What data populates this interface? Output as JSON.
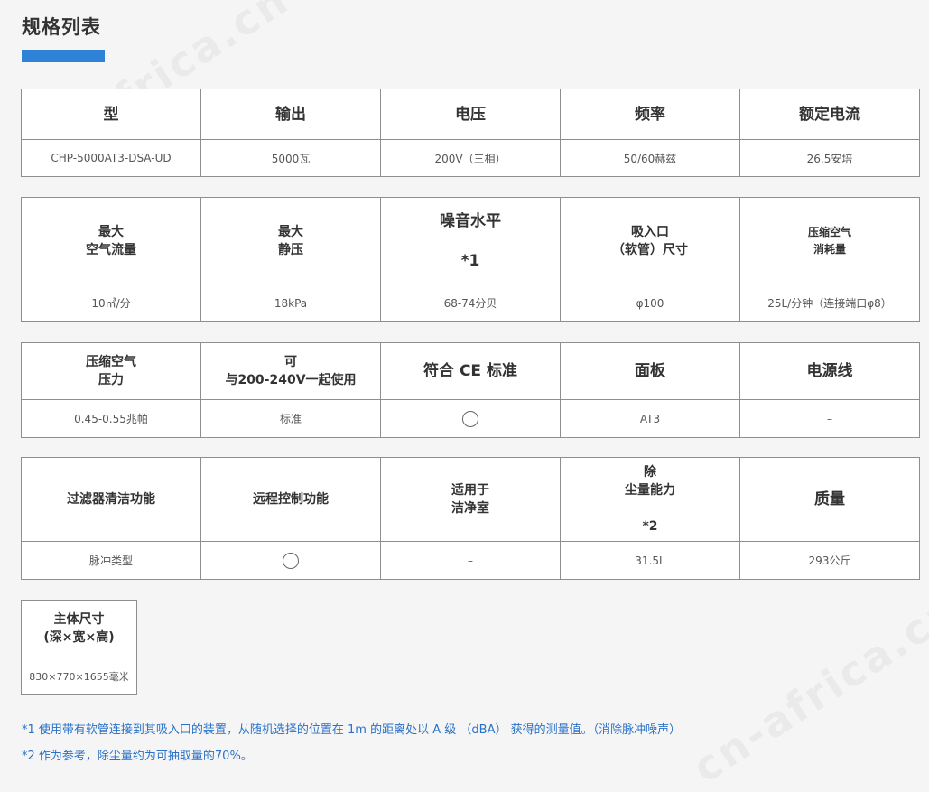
{
  "title": "规格列表",
  "accent_color": "#2f83d6",
  "watermark": "cn-africa.cn",
  "table1": {
    "headers": [
      "型",
      "输出",
      "电压",
      "频率",
      "额定电流"
    ],
    "values": [
      "CHP-5000AT3-DSA-UD",
      "5000瓦",
      "200V（三相）",
      "50/60赫兹",
      "26.5安培"
    ]
  },
  "table2": {
    "headers": [
      "最大\n空气流量",
      "最大\n静压",
      "噪音水平\n\n*1",
      "吸入口\n（软管）尺寸",
      "压缩空气\n消耗量"
    ],
    "values": [
      "10㎥/分",
      "18kPa",
      "68-74分贝",
      "φ100",
      "25L/分钟（连接端口φ8）"
    ]
  },
  "table3": {
    "headers": [
      "压缩空气\n压力",
      "可\n与200-240V一起使用",
      "符合 CE 标准",
      "面板",
      "电源线"
    ],
    "values": [
      "0.45-0.55兆帕",
      "标准",
      "",
      "AT3",
      "–"
    ]
  },
  "table4": {
    "headers": [
      "过滤器清洁功能",
      "远程控制功能",
      "适用于\n洁净室",
      "除\n尘量能力\n\n*2",
      "质量"
    ],
    "values": [
      "脉冲类型",
      "",
      "–",
      "31.5L",
      "293公斤"
    ]
  },
  "table5": {
    "header": "主体尺寸\n(深×宽×高)",
    "value": "830×770×1655毫米"
  },
  "notes": [
    "*1 使用带有软管连接到其吸入口的装置，从随机选择的位置在 1m 的距离处以 A 级 （dBA） 获得的测量值。（消除脉冲噪声）",
    "*2 作为参考，除尘量约为可抽取量的70%。"
  ]
}
